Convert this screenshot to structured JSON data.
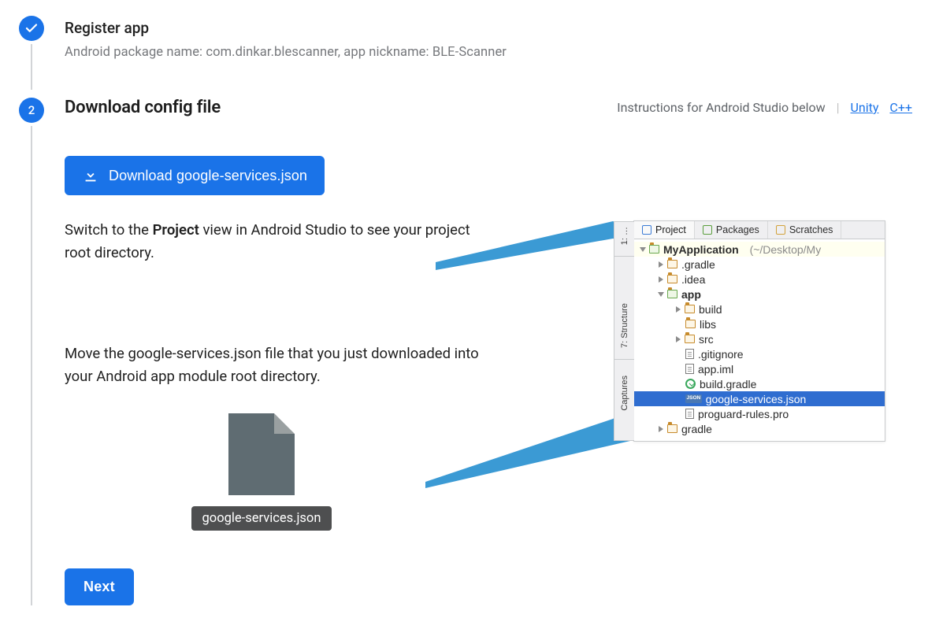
{
  "step1": {
    "title": "Register app",
    "subtitle": "Android package name: com.dinkar.blescanner, app nickname: BLE-Scanner"
  },
  "step2": {
    "number": "2",
    "title": "Download config file",
    "instructionsText": "Instructions for Android Studio below",
    "divider": "|",
    "linkUnity": "Unity",
    "linkCpp": "C++",
    "downloadLabel": "Download google-services.json",
    "para1_pre": "Switch to the ",
    "para1_bold": "Project",
    "para1_post": " view in Android Studio to see your project root directory.",
    "para2": "Move the google-services.json file that you just downloaded into your Android app module root directory.",
    "fileLabel": "google-services.json",
    "nextLabel": "Next"
  },
  "as": {
    "sideTop": "1: …",
    "sideStructure": "7: Structure",
    "sideCaptures": "Captures",
    "tabProject": "Project",
    "tabPackages": "Packages",
    "tabScratches": "Scratches",
    "rootName": "MyApplication",
    "rootPath": "(~/Desktop/My",
    "items": {
      "gradleDot": ".gradle",
      "idea": ".idea",
      "app": "app",
      "build": "build",
      "libs": "libs",
      "src": "src",
      "gitignore": ".gitignore",
      "appIml": "app.iml",
      "buildGradle": "build.gradle",
      "gservices": "google-services.json",
      "proguard": "proguard-rules.pro",
      "gradle": "gradle"
    },
    "jsonBadge": "JSON"
  }
}
